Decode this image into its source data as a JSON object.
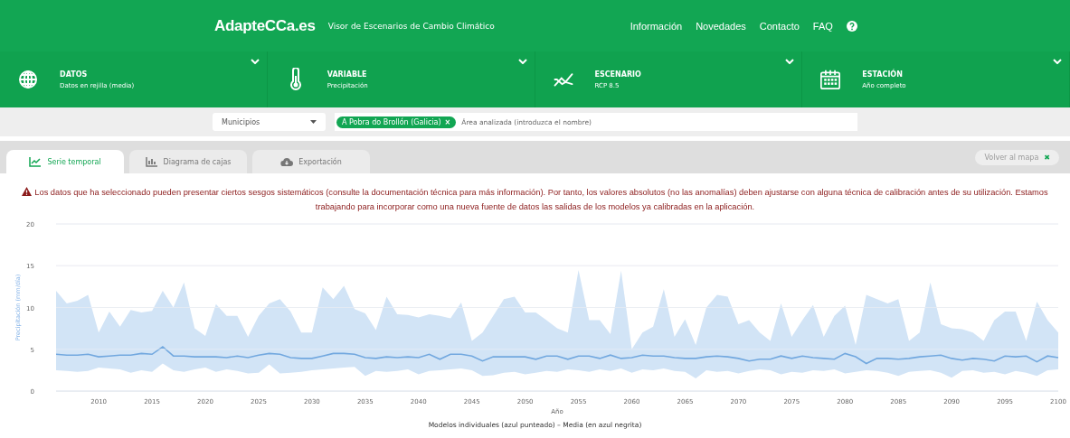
{
  "header": {
    "logo": "AdapteCCa.es",
    "subtitle": "Visor de Escenarios de Cambio Climático",
    "nav": [
      {
        "label": "Información"
      },
      {
        "label": "Novedades"
      },
      {
        "label": "Contacto"
      },
      {
        "label": "FAQ"
      }
    ]
  },
  "selectors": [
    {
      "kind": "globe",
      "title": "DATOS",
      "value": "Datos en rejilla (media)"
    },
    {
      "kind": "thermometer",
      "title": "VARIABLE",
      "value": "Precipitación"
    },
    {
      "kind": "trend",
      "title": "ESCENARIO",
      "value": "RCP 8.5"
    },
    {
      "kind": "calendar",
      "title": "ESTACIÓN",
      "value": "Año completo"
    }
  ],
  "filter": {
    "select": "Municipios",
    "tag": "A Pobra do Brollón (Galicia)",
    "tag_close": "×",
    "search": {
      "placeholder": "Área analizada (introduzca el nombre)"
    }
  },
  "tabs": [
    {
      "kind": "line",
      "label": "Serie temporal",
      "selected": true
    },
    {
      "kind": "bars",
      "label": "Diagrama de cajas",
      "selected": false
    },
    {
      "kind": "cloud",
      "label": "Exportación",
      "selected": false
    }
  ],
  "back_button": {
    "label": "Volver al mapa",
    "icon": "✖"
  },
  "warning": "Los datos que ha seleccionado pueden presentar ciertos sesgos sistemáticos (consulte la documentación técnica para más información). Por tanto, los valores absolutos (no las anomalías) deben ajustarse con alguna técnica de calibración antes de su utilización. Estamos trabajando para incorporar como una nueva fuente de datos las salidas de los modelos ya calibradas en la aplicación.",
  "chart": {
    "caption": "Modelos individuales (azul punteado) – Media (en azul negrita)",
    "chart_data": {
      "type": "area",
      "grid": true,
      "xlabel": "Año",
      "ylabel": "Precipitación (mm/día)",
      "xlim": [
        2006,
        2100
      ],
      "ylim": [
        0,
        20
      ],
      "yticks": [
        0,
        5,
        10,
        15,
        20
      ],
      "xticks": [
        2010,
        2015,
        2020,
        2025,
        2030,
        2035,
        2040,
        2045,
        2050,
        2055,
        2060,
        2065,
        2070,
        2075,
        2080,
        2085,
        2090,
        2095,
        2100
      ],
      "x": [
        2006,
        2007,
        2008,
        2009,
        2010,
        2011,
        2012,
        2013,
        2014,
        2015,
        2016,
        2017,
        2018,
        2019,
        2020,
        2021,
        2022,
        2023,
        2024,
        2025,
        2026,
        2027,
        2028,
        2029,
        2030,
        2031,
        2032,
        2033,
        2034,
        2035,
        2036,
        2037,
        2038,
        2039,
        2040,
        2041,
        2042,
        2043,
        2044,
        2045,
        2046,
        2047,
        2048,
        2049,
        2050,
        2051,
        2052,
        2053,
        2054,
        2055,
        2056,
        2057,
        2058,
        2059,
        2060,
        2061,
        2062,
        2063,
        2064,
        2065,
        2066,
        2067,
        2068,
        2069,
        2070,
        2071,
        2072,
        2073,
        2074,
        2075,
        2076,
        2077,
        2078,
        2079,
        2080,
        2081,
        2082,
        2083,
        2084,
        2085,
        2086,
        2087,
        2088,
        2089,
        2090,
        2091,
        2092,
        2093,
        2094,
        2095,
        2096,
        2097,
        2098,
        2099,
        2100
      ],
      "series": [
        {
          "color": "#d2e4f6",
          "values": [
            12,
            10.5,
            10.8,
            11.5,
            7,
            9.5,
            7.7,
            9.7,
            9.4,
            9.6,
            12,
            10,
            13,
            7.5,
            6.6,
            10.4,
            9,
            9,
            6.5,
            9,
            10.5,
            11,
            9.5,
            7,
            7,
            12.4,
            11,
            12.6,
            9.8,
            9.3,
            7.3,
            11.3,
            9.2,
            9.1,
            8.8,
            9.2,
            9,
            8.7,
            10.6,
            6,
            7,
            9,
            11,
            11.3,
            9.4,
            9.4,
            8.5,
            7.5,
            7,
            14.5,
            8.5,
            8.5,
            6.8,
            14.4,
            5,
            7,
            7.7,
            12.2,
            6.5,
            8.6,
            5.5,
            10,
            11.5,
            11.3,
            8,
            8.5,
            7,
            6,
            10.5,
            6.5,
            8.5,
            10.3,
            6.5,
            9,
            10.2,
            5.5,
            11.5,
            11,
            10.5,
            11,
            6,
            7,
            13,
            8,
            7.5,
            7.4,
            7,
            6,
            8.5,
            9.5,
            9.5,
            6,
            10.7,
            8.5,
            7
          ]
        },
        {
          "color": "#ffffff",
          "values": [
            2.5,
            2.4,
            2.3,
            2.4,
            2.8,
            2.7,
            2.6,
            2.2,
            2.5,
            2.3,
            3.3,
            2.5,
            2.3,
            2.6,
            2.8,
            2.3,
            2.6,
            2.4,
            2.1,
            2.2,
            3.2,
            2.1,
            2.2,
            2.3,
            2.5,
            2.6,
            2.7,
            2.8,
            2.9,
            1.8,
            2.4,
            2.3,
            2.4,
            2.6,
            2.0,
            2.4,
            2.5,
            2.6,
            2.7,
            2.5,
            1.8,
            1.9,
            2.2,
            2.3,
            2.0,
            2.2,
            2.4,
            2.3,
            2.6,
            2.5,
            2.3,
            2.6,
            2.4,
            2.7,
            2.2,
            2.6,
            2.5,
            2.7,
            2.4,
            2.3,
            1.5,
            2.5,
            2.3,
            2.4,
            2.1,
            2.4,
            2.6,
            2.5,
            2.0,
            2.3,
            2.2,
            2.5,
            2.4,
            2.6,
            2.1,
            2.3,
            2.5,
            2.4,
            2.2,
            1.8,
            2.3,
            2.4,
            2.5,
            2.2,
            1.6,
            2.4,
            2.5,
            2.2,
            2.3,
            2.0,
            2.4,
            2.2,
            1.8,
            2.5,
            2.6
          ]
        },
        {
          "type": "line",
          "color": "#72a8df",
          "values": [
            4.4,
            4.3,
            4.3,
            4.4,
            4.1,
            4.2,
            4.3,
            4.3,
            4.5,
            4.4,
            5.3,
            4.2,
            4.2,
            4.1,
            4.1,
            4.1,
            4.0,
            4.2,
            4.0,
            4.3,
            4.5,
            4.4,
            4.0,
            3.9,
            3.9,
            4.2,
            4.5,
            4.5,
            4.4,
            4.0,
            3.9,
            4.1,
            4.0,
            4.1,
            4.0,
            4.4,
            3.8,
            4.4,
            4.4,
            4.2,
            3.6,
            4.1,
            4.1,
            4.1,
            4.1,
            3.8,
            4.2,
            4.2,
            3.8,
            4.2,
            4.2,
            3.9,
            4.3,
            3.9,
            4.0,
            4.3,
            4.2,
            4.2,
            4.0,
            3.9,
            3.9,
            4.1,
            4.2,
            4.1,
            3.9,
            3.6,
            3.8,
            3.8,
            4.2,
            3.9,
            4.2,
            4.0,
            3.9,
            3.8,
            4.5,
            4.1,
            3.3,
            3.9,
            3.9,
            3.8,
            3.9,
            4.1,
            4.2,
            4.3,
            3.9,
            3.7,
            3.9,
            3.8,
            3.6,
            4.2,
            4.1,
            4.2,
            3.5,
            4.2,
            4.0
          ]
        }
      ]
    }
  }
}
